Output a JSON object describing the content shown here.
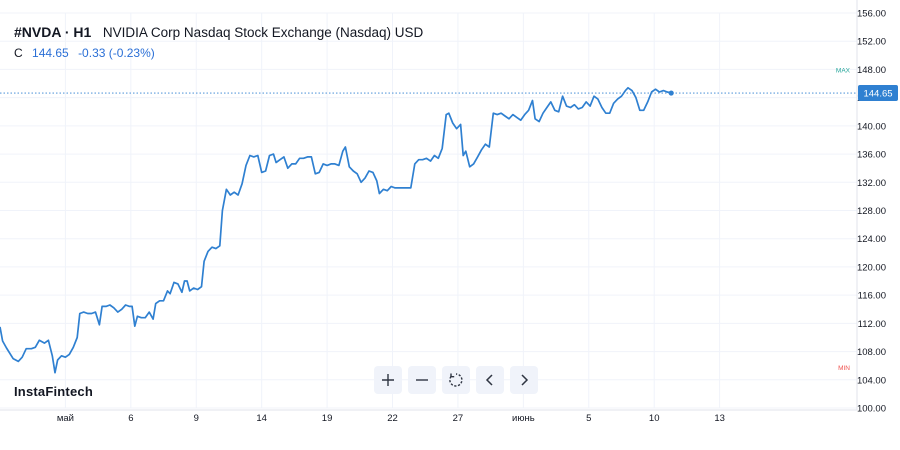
{
  "header": {
    "symbol": "#NVDA · H1",
    "description": "NVIDIA Corp Nasdaq Stock Exchange (Nasdaq) USD"
  },
  "quote": {
    "label": "C",
    "price": "144.65",
    "change": "-0.33 (-0.23%)"
  },
  "brand": "InstaFintech",
  "toolbar": {
    "buttons": [
      {
        "name": "zoom-in",
        "icon": "plus-icon"
      },
      {
        "name": "zoom-out",
        "icon": "minus-icon"
      },
      {
        "name": "reset",
        "icon": "reset-icon"
      },
      {
        "name": "scroll-left",
        "icon": "chevron-left-icon"
      },
      {
        "name": "scroll-right",
        "icon": "chevron-right-icon"
      }
    ]
  },
  "colors": {
    "line": "#2f80d1",
    "price_label_bg": "#2f80d1",
    "max_label": "#26a69a",
    "min_label": "#ef5350",
    "grid": "#f0f3fa"
  },
  "chart_data": {
    "type": "line",
    "title": "",
    "xlabel": "",
    "ylabel": "",
    "ylim": [
      100,
      156
    ],
    "y_ticks": [
      "100.00",
      "104.00",
      "108.00",
      "112.00",
      "116.00",
      "120.00",
      "124.00",
      "128.00",
      "132.00",
      "136.00",
      "140.00",
      "144.00",
      "148.00",
      "152.00",
      "156.00"
    ],
    "x_ticks": [
      {
        "label": "май",
        "x": 0
      },
      {
        "label": "6",
        "x": 5
      },
      {
        "label": "9",
        "x": 10
      },
      {
        "label": "14",
        "x": 15
      },
      {
        "label": "19",
        "x": 20
      },
      {
        "label": "22",
        "x": 25
      },
      {
        "label": "27",
        "x": 30
      },
      {
        "label": "июнь",
        "x": 35
      },
      {
        "label": "5",
        "x": 40
      },
      {
        "label": "10",
        "x": 45
      },
      {
        "label": "13",
        "x": 50
      }
    ],
    "current_price": 144.65,
    "current_price_label": "144.65",
    "max_label": "MAX",
    "min_label": "MIN",
    "max_value": 146.0,
    "min_value": 105.0,
    "grid": true,
    "series": [
      {
        "values": [
          [
            -5.0,
            111.5
          ],
          [
            -4.8,
            109.5
          ],
          [
            -4.5,
            108.5
          ],
          [
            -4.0,
            107.0
          ],
          [
            -3.6,
            106.6
          ],
          [
            -3.3,
            107.2
          ],
          [
            -3.0,
            108.4
          ],
          [
            -2.6,
            108.4
          ],
          [
            -2.3,
            108.6
          ],
          [
            -2.0,
            109.6
          ],
          [
            -1.6,
            109.2
          ],
          [
            -1.3,
            109.6
          ],
          [
            -1.0,
            107.4
          ],
          [
            -0.8,
            105.0
          ],
          [
            -0.6,
            106.8
          ],
          [
            -0.3,
            107.4
          ],
          [
            0.0,
            107.2
          ],
          [
            0.3,
            107.6
          ],
          [
            0.6,
            108.6
          ],
          [
            0.9,
            110.0
          ],
          [
            1.1,
            113.4
          ],
          [
            1.4,
            113.6
          ],
          [
            1.7,
            113.4
          ],
          [
            2.0,
            113.4
          ],
          [
            2.3,
            113.6
          ],
          [
            2.6,
            111.8
          ],
          [
            2.8,
            114.4
          ],
          [
            3.1,
            114.4
          ],
          [
            3.4,
            114.6
          ],
          [
            3.7,
            114.2
          ],
          [
            4.0,
            113.6
          ],
          [
            4.3,
            114.0
          ],
          [
            4.6,
            114.6
          ],
          [
            4.9,
            114.4
          ],
          [
            5.1,
            114.4
          ],
          [
            5.3,
            111.6
          ],
          [
            5.5,
            113.0
          ],
          [
            5.8,
            112.8
          ],
          [
            6.1,
            112.8
          ],
          [
            6.4,
            113.6
          ],
          [
            6.7,
            112.6
          ],
          [
            6.9,
            114.8
          ],
          [
            7.2,
            115.2
          ],
          [
            7.5,
            115.2
          ],
          [
            7.8,
            116.6
          ],
          [
            8.0,
            116.2
          ],
          [
            8.3,
            117.8
          ],
          [
            8.6,
            117.6
          ],
          [
            8.9,
            116.4
          ],
          [
            9.1,
            118.0
          ],
          [
            9.3,
            118.0
          ],
          [
            9.5,
            116.6
          ],
          [
            9.8,
            117.0
          ],
          [
            10.1,
            116.8
          ],
          [
            10.4,
            117.2
          ],
          [
            10.6,
            120.8
          ],
          [
            10.9,
            122.2
          ],
          [
            11.2,
            122.8
          ],
          [
            11.5,
            122.6
          ],
          [
            11.8,
            123.0
          ],
          [
            12.0,
            128.0
          ],
          [
            12.3,
            131.0
          ],
          [
            12.6,
            130.2
          ],
          [
            12.9,
            130.6
          ],
          [
            13.2,
            130.2
          ],
          [
            13.5,
            131.8
          ],
          [
            13.8,
            134.4
          ],
          [
            14.1,
            135.8
          ],
          [
            14.4,
            135.6
          ],
          [
            14.7,
            135.8
          ],
          [
            15.0,
            133.4
          ],
          [
            15.3,
            133.6
          ],
          [
            15.6,
            135.8
          ],
          [
            15.9,
            136.0
          ],
          [
            16.1,
            134.8
          ],
          [
            16.4,
            135.2
          ],
          [
            16.7,
            135.6
          ],
          [
            17.0,
            134.0
          ],
          [
            17.3,
            134.6
          ],
          [
            17.6,
            134.6
          ],
          [
            17.9,
            135.4
          ],
          [
            18.2,
            135.4
          ],
          [
            18.5,
            135.6
          ],
          [
            18.8,
            135.6
          ],
          [
            19.1,
            133.2
          ],
          [
            19.4,
            133.4
          ],
          [
            19.7,
            134.6
          ],
          [
            20.0,
            134.4
          ],
          [
            20.3,
            134.6
          ],
          [
            20.6,
            134.6
          ],
          [
            20.9,
            134.4
          ],
          [
            21.2,
            136.4
          ],
          [
            21.4,
            137.0
          ],
          [
            21.7,
            134.2
          ],
          [
            22.0,
            133.6
          ],
          [
            22.3,
            133.2
          ],
          [
            22.6,
            132.0
          ],
          [
            22.9,
            132.6
          ],
          [
            23.2,
            133.6
          ],
          [
            23.5,
            133.4
          ],
          [
            23.8,
            132.2
          ],
          [
            24.0,
            130.4
          ],
          [
            24.3,
            131.0
          ],
          [
            24.6,
            130.8
          ],
          [
            24.9,
            131.4
          ],
          [
            25.2,
            131.2
          ],
          [
            25.5,
            131.2
          ],
          [
            25.8,
            131.2
          ],
          [
            26.1,
            131.2
          ],
          [
            26.4,
            131.2
          ],
          [
            26.7,
            134.6
          ],
          [
            27.0,
            135.2
          ],
          [
            27.3,
            135.2
          ],
          [
            27.6,
            135.4
          ],
          [
            27.9,
            135.0
          ],
          [
            28.2,
            135.8
          ],
          [
            28.5,
            135.4
          ],
          [
            28.8,
            136.8
          ],
          [
            29.1,
            141.6
          ],
          [
            29.3,
            141.8
          ],
          [
            29.6,
            140.4
          ],
          [
            29.9,
            139.6
          ],
          [
            30.2,
            140.2
          ],
          [
            30.4,
            135.8
          ],
          [
            30.6,
            136.4
          ],
          [
            30.9,
            134.2
          ],
          [
            31.2,
            134.6
          ],
          [
            31.5,
            135.6
          ],
          [
            31.8,
            136.6
          ],
          [
            32.1,
            137.4
          ],
          [
            32.4,
            137.0
          ],
          [
            32.7,
            141.8
          ],
          [
            33.0,
            141.6
          ],
          [
            33.3,
            141.8
          ],
          [
            33.6,
            141.4
          ],
          [
            33.9,
            141.0
          ],
          [
            34.2,
            141.6
          ],
          [
            34.5,
            141.2
          ],
          [
            34.8,
            140.8
          ],
          [
            35.1,
            141.6
          ],
          [
            35.4,
            142.2
          ],
          [
            35.7,
            143.6
          ],
          [
            35.9,
            141.0
          ],
          [
            36.2,
            140.6
          ],
          [
            36.5,
            141.8
          ],
          [
            36.8,
            142.6
          ],
          [
            37.1,
            143.4
          ],
          [
            37.4,
            142.2
          ],
          [
            37.7,
            142.0
          ],
          [
            38.0,
            144.2
          ],
          [
            38.3,
            142.8
          ],
          [
            38.6,
            142.6
          ],
          [
            38.9,
            143.0
          ],
          [
            39.2,
            142.4
          ],
          [
            39.5,
            142.6
          ],
          [
            39.8,
            143.4
          ],
          [
            40.1,
            142.8
          ],
          [
            40.4,
            144.2
          ],
          [
            40.7,
            143.8
          ],
          [
            41.0,
            142.6
          ],
          [
            41.3,
            141.8
          ],
          [
            41.6,
            141.8
          ],
          [
            41.9,
            143.2
          ],
          [
            42.2,
            143.8
          ],
          [
            42.5,
            144.2
          ],
          [
            42.8,
            145.0
          ],
          [
            43.0,
            145.4
          ],
          [
            43.3,
            145.0
          ],
          [
            43.6,
            144.0
          ],
          [
            43.9,
            142.2
          ],
          [
            44.2,
            142.2
          ],
          [
            44.5,
            143.4
          ],
          [
            44.8,
            144.8
          ],
          [
            45.1,
            145.2
          ],
          [
            45.4,
            144.8
          ],
          [
            45.7,
            145.0
          ],
          [
            46.0,
            144.8
          ],
          [
            46.3,
            144.65
          ]
        ]
      }
    ]
  }
}
